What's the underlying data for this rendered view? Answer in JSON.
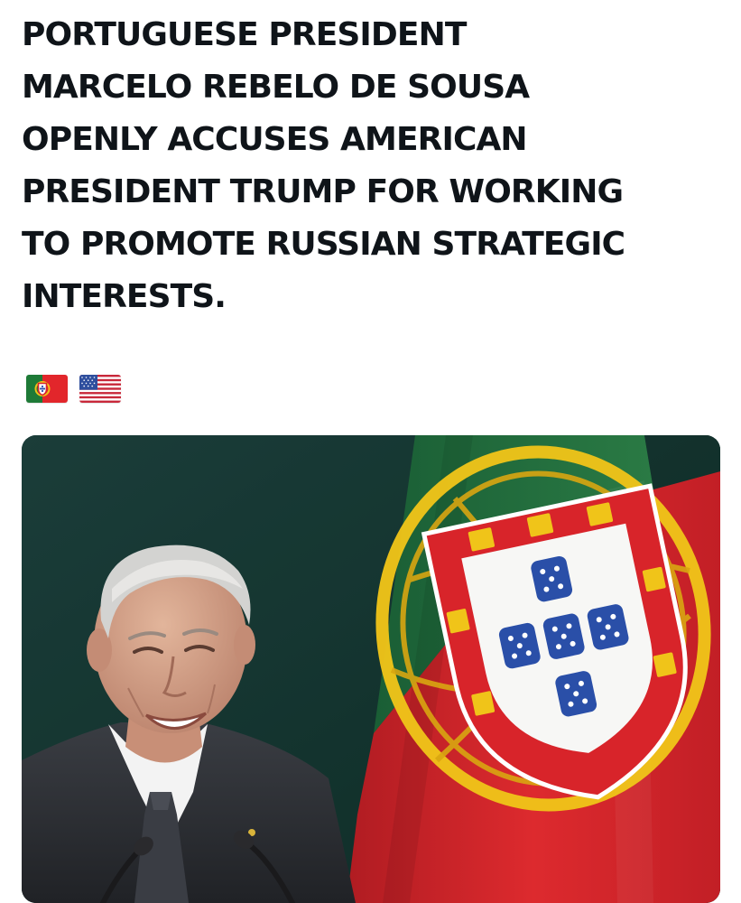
{
  "post": {
    "headline_lines": [
      "PORTUGUESE PRESIDENT",
      "MARCELO REBELO DE SOUSA",
      "OPENLY ACCUSES AMERICAN",
      "PRESIDENT TRUMP FOR WORKING",
      "TO PROMOTE RUSSIAN STRATEGIC",
      "INTERESTS."
    ],
    "flags": [
      {
        "icon": "portugal-flag-icon"
      },
      {
        "icon": "usa-flag-icon"
      }
    ],
    "media": {
      "icon": "photo-president-with-portuguese-flag",
      "colors": {
        "background": "#12352f",
        "flag_green": "#1f6b3a",
        "flag_red": "#d8242a",
        "flag_gold": "#f0c419",
        "shield_blue": "#2a4fa8",
        "suit": "#2e3136"
      }
    }
  }
}
